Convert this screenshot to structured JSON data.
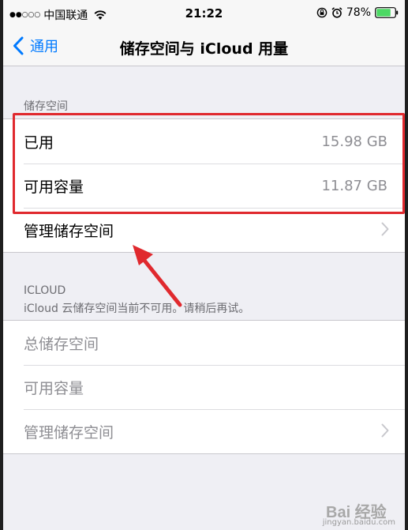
{
  "status_bar": {
    "signal": "●●○○○",
    "carrier": "中国联通",
    "time": "21:22",
    "battery_percent": "78%",
    "battery_level": 0.78,
    "icons": [
      "wifi-icon",
      "orientation-lock-icon",
      "alarm-icon",
      "battery-icon"
    ]
  },
  "nav": {
    "back_label": "通用",
    "title": "储存空间与 iCloud 用量"
  },
  "storage": {
    "header": "储存空间",
    "rows": [
      {
        "label": "已用",
        "value": "15.98 GB"
      },
      {
        "label": "可用容量",
        "value": "11.87 GB"
      },
      {
        "label": "管理储存空间"
      }
    ]
  },
  "icloud": {
    "header": "ICLOUD",
    "footer": "iCloud 云储存空间当前不可用。请稍后再试。",
    "rows": [
      {
        "label": "总储存空间"
      },
      {
        "label": "可用容量"
      },
      {
        "label": "管理储存空间"
      }
    ]
  },
  "watermark": {
    "logo": "Bai 经验",
    "url": "jingyan.baidu.com"
  },
  "colors": {
    "accent": "#007aff",
    "annotation": "#e0292e",
    "background": "#efeff4"
  }
}
